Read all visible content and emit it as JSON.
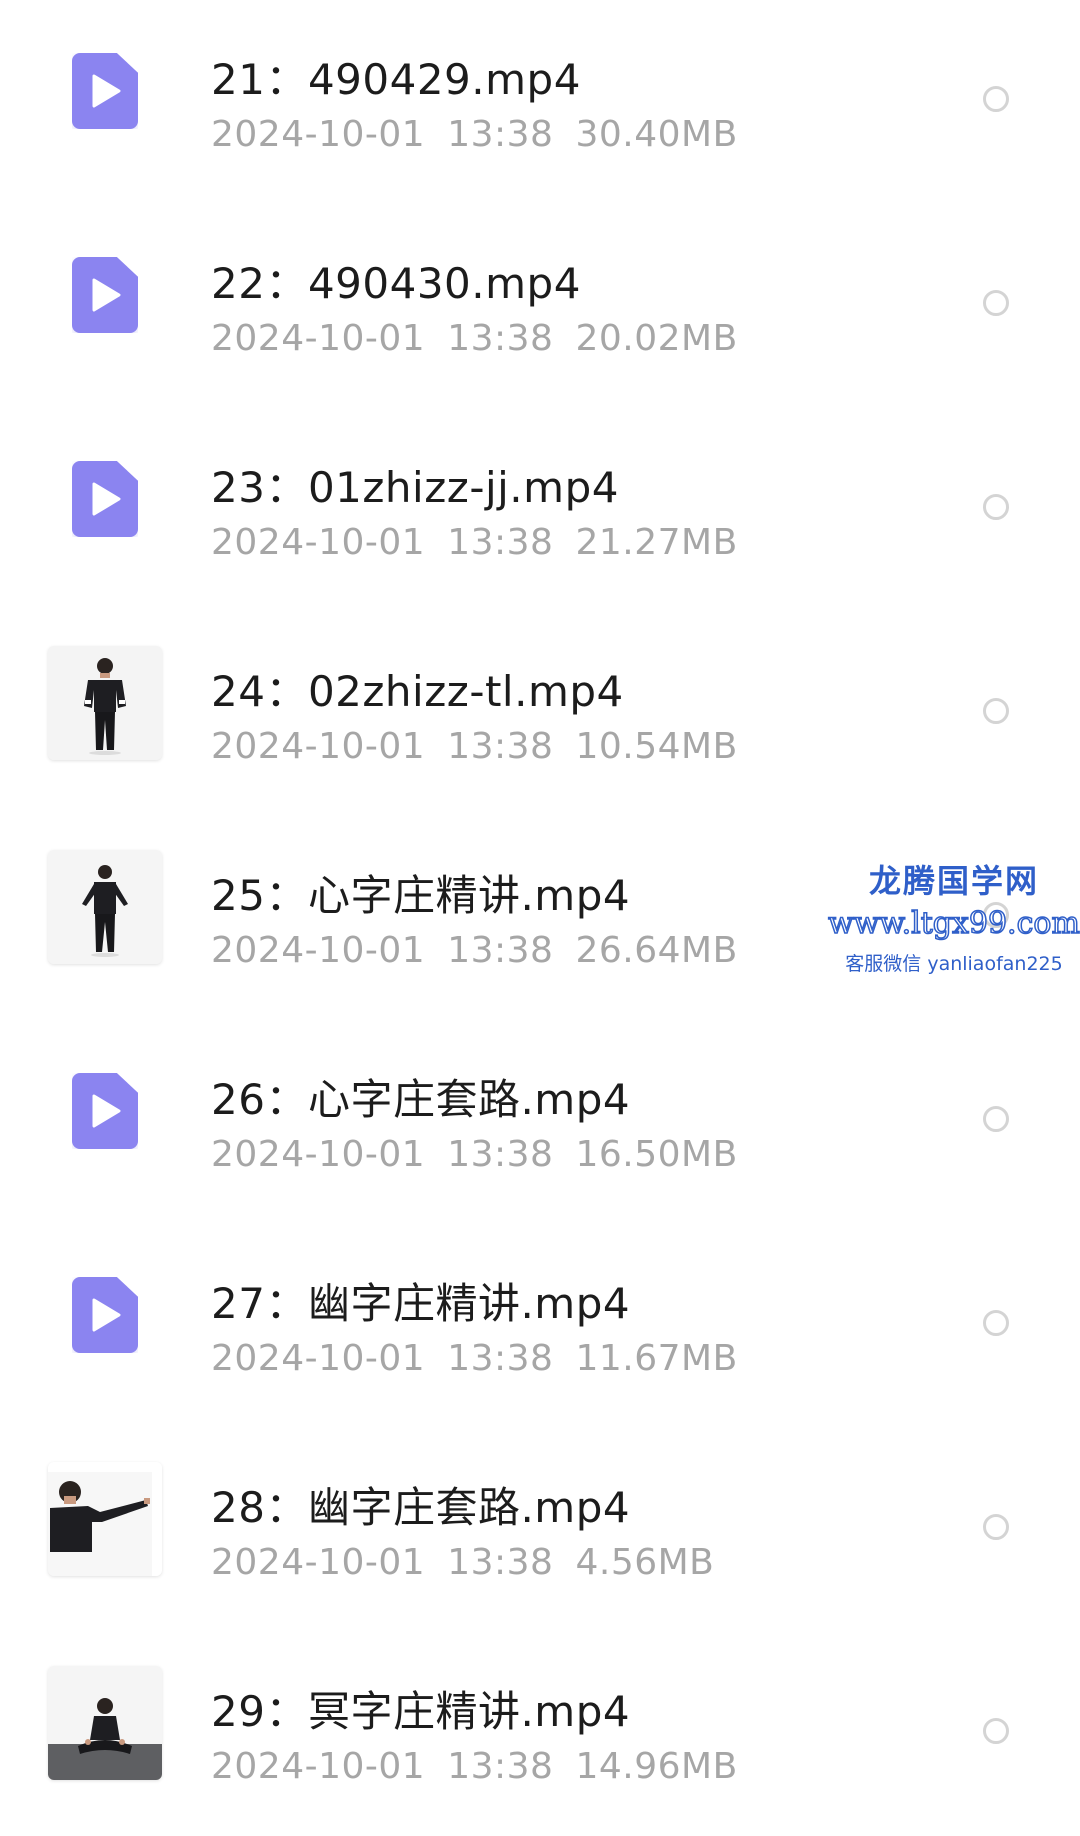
{
  "files": [
    {
      "name": "21：490429.mp4",
      "date": "2024-10-01",
      "time": "13:38",
      "size": "30.40MB",
      "thumb": "video-icon"
    },
    {
      "name": "22：490430.mp4",
      "date": "2024-10-01",
      "time": "13:38",
      "size": "20.02MB",
      "thumb": "video-icon"
    },
    {
      "name": "23：01zhizz-jj.mp4",
      "date": "2024-10-01",
      "time": "13:38",
      "size": "21.27MB",
      "thumb": "video-icon"
    },
    {
      "name": "24：02zhizz-tl.mp4",
      "date": "2024-10-01",
      "time": "13:38",
      "size": "10.54MB",
      "thumb": "photo-standing"
    },
    {
      "name": "25：心字庄精讲.mp4",
      "date": "2024-10-01",
      "time": "13:38",
      "size": "26.64MB",
      "thumb": "photo-arms-out"
    },
    {
      "name": "26：心字庄套路.mp4",
      "date": "2024-10-01",
      "time": "13:38",
      "size": "16.50MB",
      "thumb": "video-icon"
    },
    {
      "name": "27：幽字庄精讲.mp4",
      "date": "2024-10-01",
      "time": "13:38",
      "size": "11.67MB",
      "thumb": "video-icon"
    },
    {
      "name": "28：幽字庄套路.mp4",
      "date": "2024-10-01",
      "time": "13:38",
      "size": "4.56MB",
      "thumb": "photo-arm-extended"
    },
    {
      "name": "29：冥字庄精讲.mp4",
      "date": "2024-10-01",
      "time": "13:38",
      "size": "14.96MB",
      "thumb": "photo-seated"
    }
  ],
  "watermark": {
    "title": "龙腾国学网",
    "url": "www.ltgx99.com",
    "contact": "客服微信 yanliaofan225"
  },
  "colors": {
    "video_icon": "#8b84f0",
    "name_text": "#1c1c1c",
    "meta_text": "#a6a6a6",
    "radio_border": "#d4d4d4",
    "watermark": "#2f5fc9"
  }
}
